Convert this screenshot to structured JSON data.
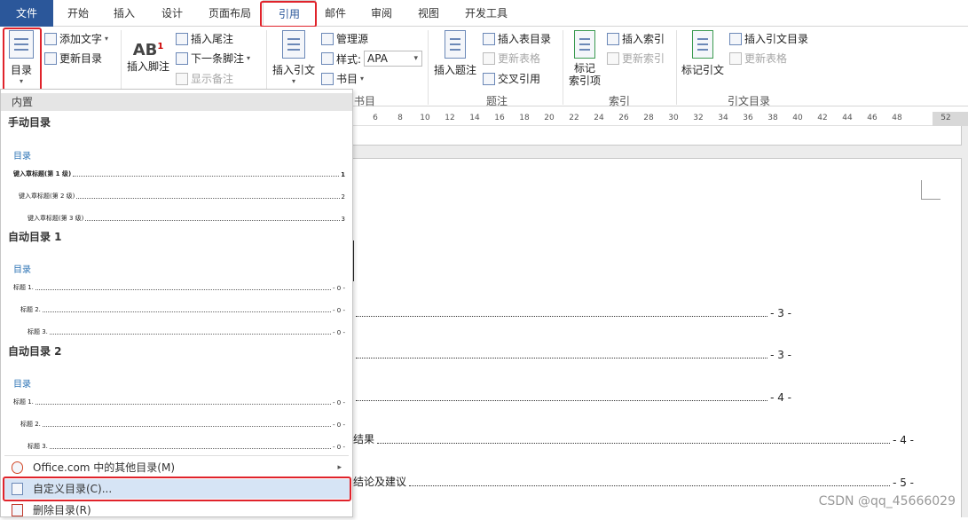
{
  "tabs": [
    "文件",
    "开始",
    "插入",
    "设计",
    "页面布局",
    "引用",
    "邮件",
    "审阅",
    "视图",
    "开发工具"
  ],
  "ribbon": {
    "toc_button": "目录",
    "add_text": "添加文字",
    "update_toc": "更新目录",
    "insert_footnote": "插入脚注",
    "insert_endnote": "插入尾注",
    "next_footnote": "下一条脚注",
    "show_notes": "显示备注",
    "insert_citation": "插入引文",
    "manage_sources": "管理源",
    "style_label": "样式:",
    "style_value": "APA",
    "bibliography": "书目",
    "group_citations_partial": "书目",
    "insert_caption": "插入题注",
    "insert_table_of_figures": "插入表目录",
    "update_table": "更新表格",
    "cross_reference": "交叉引用",
    "group_captions": "题注",
    "mark_entry": "标记\n索引项",
    "insert_index": "插入索引",
    "update_index": "更新索引",
    "group_index": "索引",
    "mark_citation": "标记引文",
    "insert_table_of_authorities": "插入引文目录",
    "update_table_2": "更新表格",
    "group_toa": "引文目录"
  },
  "ruler_ticks": [
    "6",
    "8",
    "10",
    "12",
    "14",
    "16",
    "18",
    "20",
    "22",
    "24",
    "26",
    "28",
    "30",
    "32",
    "34",
    "36",
    "38",
    "40",
    "42",
    "44",
    "46",
    "48",
    "52"
  ],
  "document": {
    "toc_lines": [
      {
        "text": "",
        "page": "- 3 -"
      },
      {
        "text": "",
        "page": "- 3 -"
      },
      {
        "text": "",
        "page": "- 4 -"
      },
      {
        "text": "结果",
        "page": "- 4 -"
      },
      {
        "text": "结论及建议",
        "page": "- 5 -"
      }
    ]
  },
  "dropdown": {
    "header": "内置",
    "sections": [
      {
        "title": "手动目录",
        "heading": "目录",
        "rows": [
          {
            "label": "键入章标题(第 1 级)",
            "page": "1"
          },
          {
            "label": "键入章标题(第 2 级)",
            "page": "2"
          },
          {
            "label": "键入章标题(第 3 级)",
            "page": "3"
          }
        ]
      },
      {
        "title": "自动目录 1",
        "heading": "目录",
        "rows": [
          {
            "label": "标题 1.",
            "page": "- 0 -"
          },
          {
            "label": "标题 2.",
            "page": "- 0 -"
          },
          {
            "label": "标题 3.",
            "page": "- 0 -"
          }
        ]
      },
      {
        "title": "自动目录 2",
        "heading": "目录",
        "rows": [
          {
            "label": "标题 1.",
            "page": "- 0 -"
          },
          {
            "label": "标题 2.",
            "page": "- 0 -"
          },
          {
            "label": "标题 3.",
            "page": "- 0 -"
          }
        ]
      }
    ],
    "more_online": "Office.com 中的其他目录(M)",
    "custom_toc": "自定义目录(C)...",
    "remove_toc": "删除目录(R)"
  },
  "watermark": "CSDN @qq_45666029",
  "colors": {
    "accent": "#2b579a",
    "highlight_box": "#e0232b",
    "menu_hover": "#d6e4f5"
  }
}
